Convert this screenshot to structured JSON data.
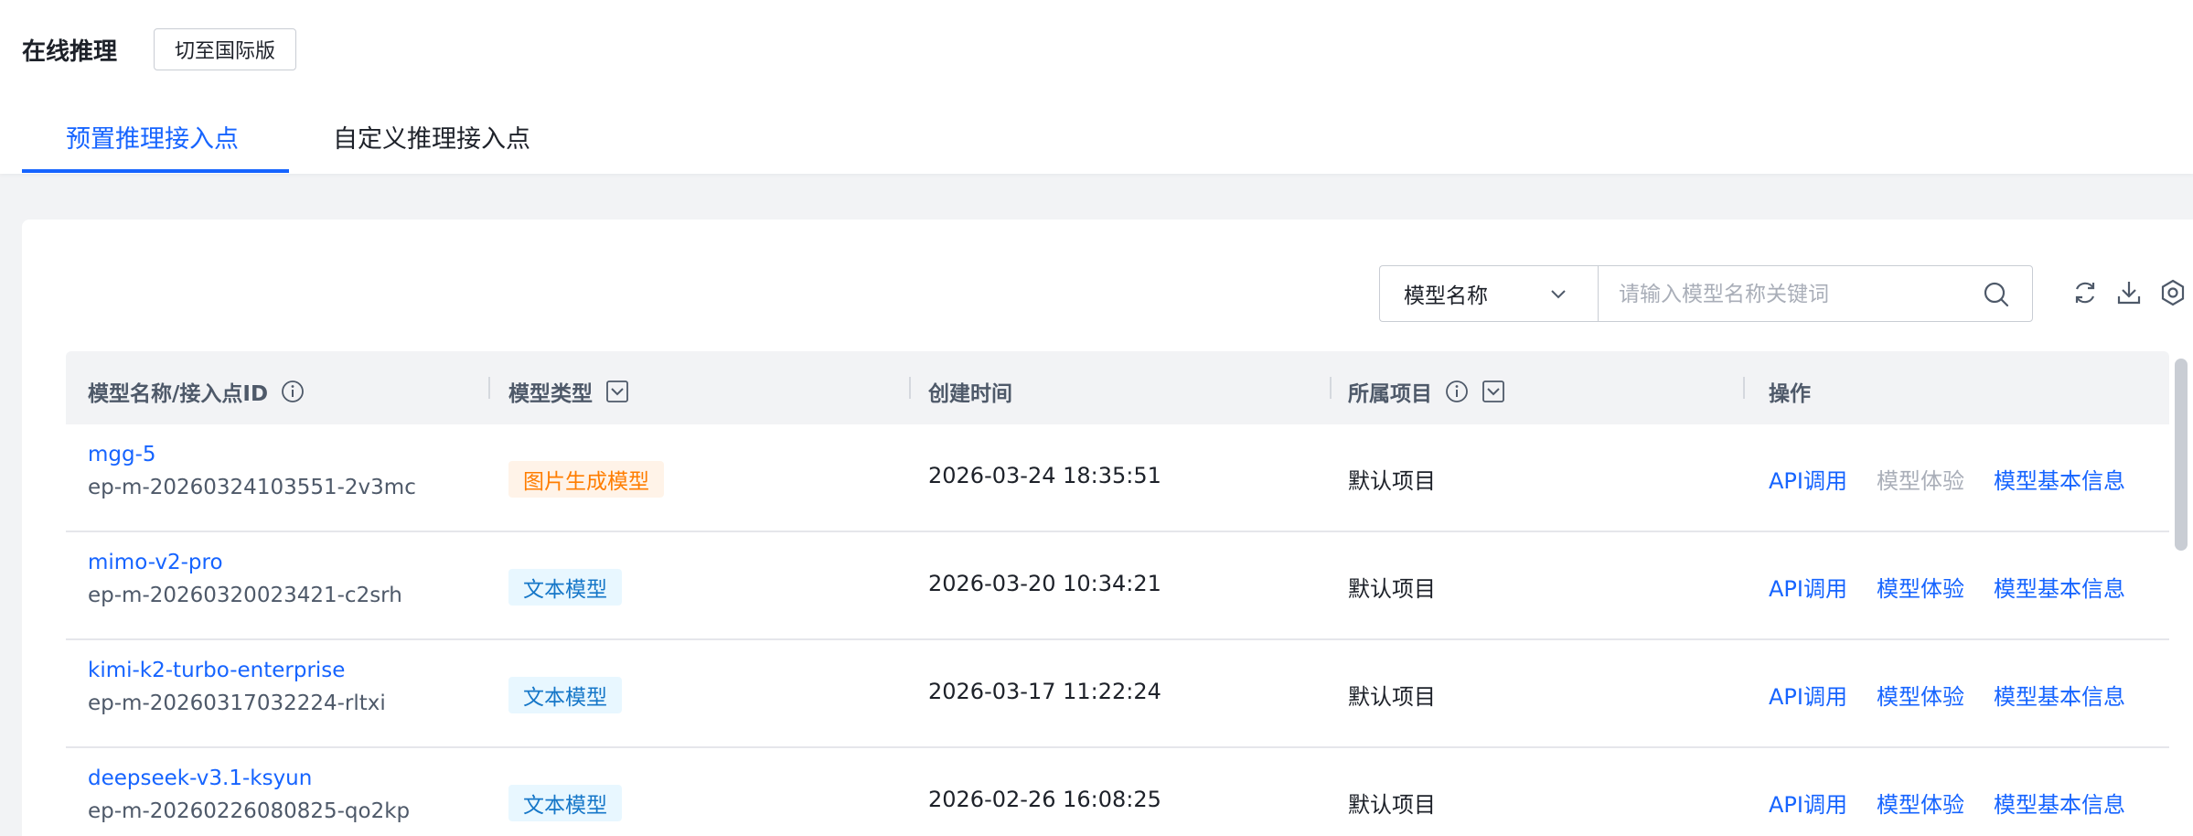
{
  "header": {
    "title": "在线推理",
    "switch_label": "切至国际版"
  },
  "tabs": [
    {
      "label": "预置推理接入点",
      "active": true
    },
    {
      "label": "自定义推理接入点",
      "active": false
    }
  ],
  "filter": {
    "select_value": "模型名称",
    "search_placeholder": "请输入模型名称关键词"
  },
  "table": {
    "columns": [
      {
        "label": "模型名称/接入点ID",
        "has_info": true,
        "has_filter": false
      },
      {
        "label": "模型类型",
        "has_info": false,
        "has_filter": true
      },
      {
        "label": "创建时间",
        "has_info": false,
        "has_filter": false
      },
      {
        "label": "所属项目",
        "has_info": true,
        "has_filter": true
      },
      {
        "label": "操作",
        "has_info": false,
        "has_filter": false
      }
    ],
    "rows": [
      {
        "name": "mgg-5",
        "endpoint_id": "ep-m-20260324103551-2v3mc",
        "type": "图片生成模型",
        "type_color": "#ff7d00",
        "created": "2026-03-24 18:35:51",
        "project": "默认项目",
        "actions": {
          "api": "API调用",
          "try": "模型体验",
          "info": "模型基本信息"
        },
        "try_disabled": true
      },
      {
        "name": "mimo-v2-pro",
        "endpoint_id": "ep-m-20260320023421-c2srh",
        "type": "文本模型",
        "type_color": "#1677c8",
        "created": "2026-03-20 10:34:21",
        "project": "默认项目",
        "actions": {
          "api": "API调用",
          "try": "模型体验",
          "info": "模型基本信息"
        },
        "try_disabled": false
      },
      {
        "name": "kimi-k2-turbo-enterprise",
        "endpoint_id": "ep-m-20260317032224-rltxi",
        "type": "文本模型",
        "type_color": "#1677c8",
        "created": "2026-03-17 11:22:24",
        "project": "默认项目",
        "actions": {
          "api": "API调用",
          "try": "模型体验",
          "info": "模型基本信息"
        },
        "try_disabled": false
      },
      {
        "name": "deepseek-v3.1-ksyun",
        "endpoint_id": "ep-m-20260226080825-qo2kp",
        "type": "文本模型",
        "type_color": "#1677c8",
        "created": "2026-02-26 16:08:25",
        "project": "默认项目",
        "actions": {
          "api": "API调用",
          "try": "模型体验",
          "info": "模型基本信息"
        },
        "try_disabled": false
      }
    ]
  },
  "colors": {
    "accent": "#1664ff",
    "disabled": "#a9aeb8"
  },
  "icons": [
    "chevron-down-icon",
    "search-icon",
    "refresh-icon",
    "download-icon",
    "settings-icon",
    "info-icon",
    "filter-icon"
  ]
}
